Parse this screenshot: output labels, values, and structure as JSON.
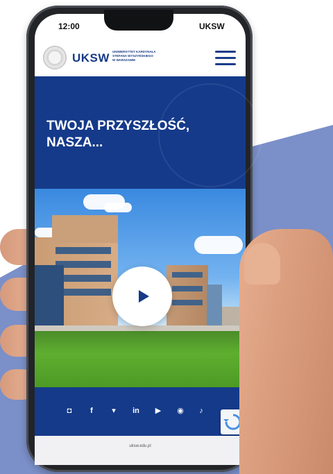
{
  "status_bar": {
    "time": "12:00",
    "carrier": "UKSW"
  },
  "header": {
    "logo": "UKSW",
    "logo_subtitle": [
      "UNIWERSYTET KARDYNAŁA",
      "STEFANA WYSZYŃSKIEGO",
      "W WARSZAWIE"
    ],
    "menu_icon": "hamburger-icon"
  },
  "hero": {
    "title": [
      "TWOJA PRZYSZŁOŚĆ,",
      "NASZA..."
    ]
  },
  "video": {
    "play_icon": "play-icon"
  },
  "social": {
    "icons": [
      "instagram-icon",
      "facebook-icon",
      "twitter-icon",
      "linkedin-icon",
      "youtube-icon",
      "spotify-icon",
      "tiktok-icon"
    ],
    "labels": [
      "◘",
      "f",
      "▾",
      "in",
      "▶",
      "◉",
      "♪"
    ]
  },
  "url_bar": {
    "text": "uksw.edu.pl"
  },
  "colors": {
    "brand_blue": "#153a8a",
    "background_accent": "#7b8fc8"
  }
}
